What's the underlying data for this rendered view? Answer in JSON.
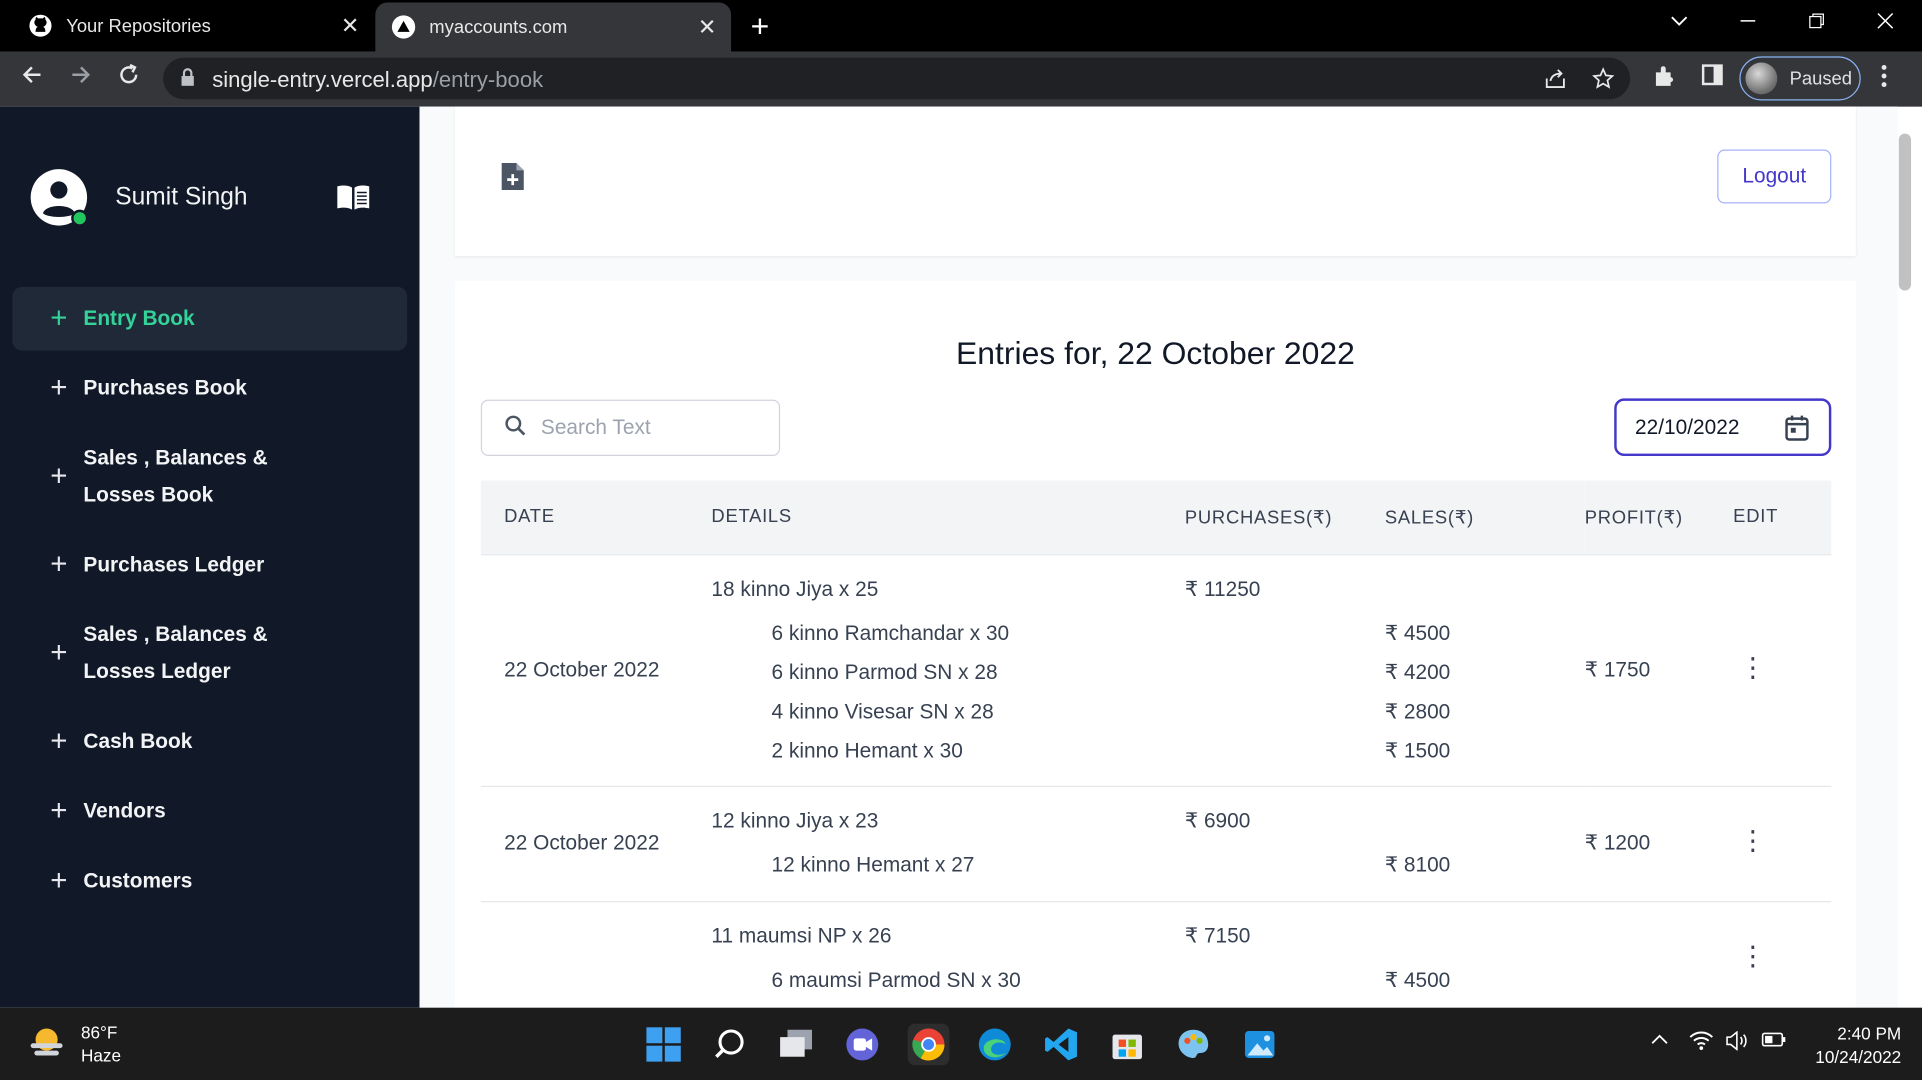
{
  "browser": {
    "tabs": [
      {
        "title": "Your Repositories",
        "icon": "github-icon"
      },
      {
        "title": "myaccounts.com",
        "icon": "vercel-icon"
      }
    ],
    "url_host": "single-entry.vercel.app",
    "url_path": "/entry-book",
    "profile_label": "Paused"
  },
  "sidebar": {
    "user_name": "Sumit Singh",
    "items": [
      {
        "label": "Entry Book",
        "active": true
      },
      {
        "label": "Purchases Book"
      },
      {
        "label": "Sales , Balances & Losses Book"
      },
      {
        "label": "Purchases Ledger"
      },
      {
        "label": "Sales , Balances & Losses Ledger"
      },
      {
        "label": "Cash Book"
      },
      {
        "label": "Vendors"
      },
      {
        "label": "Customers"
      }
    ]
  },
  "header": {
    "logout_label": "Logout"
  },
  "entries": {
    "title": "Entries for, 22 October 2022",
    "search_placeholder": "Search Text",
    "date_value": "22/10/2022",
    "columns": [
      "DATE",
      "DETAILS",
      "PURCHASES(₹)",
      "SALES(₹)",
      "PROFIT(₹)",
      "EDIT"
    ],
    "rows": [
      {
        "date": "22 October 2022",
        "purchase_detail": "18 kinno Jiya x 25",
        "purchase_amount": "₹ 11250",
        "sales": [
          {
            "detail": "6 kinno Ramchandar x 30",
            "amount": "₹ 4500"
          },
          {
            "detail": "6 kinno Parmod SN x 28",
            "amount": "₹ 4200"
          },
          {
            "detail": "4 kinno Visesar SN x 28",
            "amount": "₹ 2800"
          },
          {
            "detail": "2 kinno Hemant x 30",
            "amount": "₹ 1500"
          }
        ],
        "profit": "₹ 1750"
      },
      {
        "date": "22 October 2022",
        "purchase_detail": "12 kinno Jiya x 23",
        "purchase_amount": "₹ 6900",
        "sales": [
          {
            "detail": "12 kinno Hemant x 27",
            "amount": "₹ 8100"
          }
        ],
        "profit": "₹ 1200"
      },
      {
        "date": "",
        "purchase_detail": "11 maumsi NP x 26",
        "purchase_amount": "₹ 7150",
        "sales": [
          {
            "detail": "6 maumsi Parmod SN x 30",
            "amount": "₹ 4500"
          }
        ],
        "profit": ""
      }
    ]
  },
  "taskbar": {
    "temperature": "86°F",
    "condition": "Haze",
    "time": "2:40 PM",
    "date": "10/24/2022"
  }
}
